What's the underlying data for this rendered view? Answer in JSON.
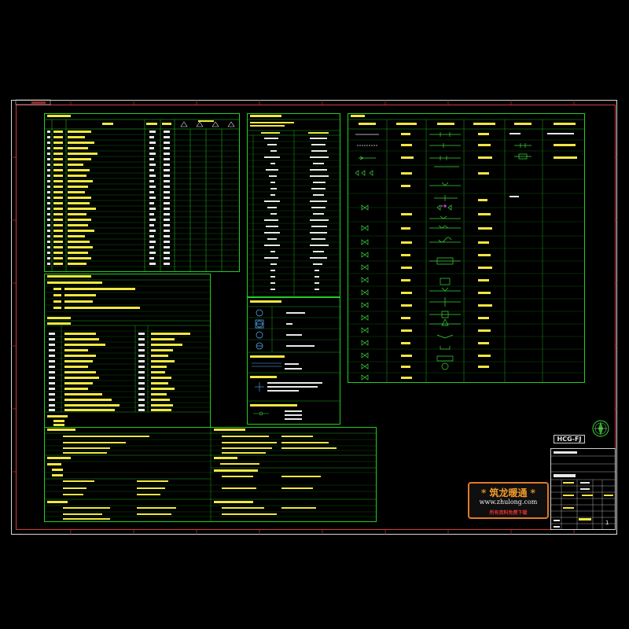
{
  "drawing": {
    "code": "HCG-FJ",
    "sheet_number": "1"
  },
  "watermark": {
    "title": "* 筑龙暖通 *",
    "url": "www.zhulong.com",
    "note": "所有资料免费下载"
  },
  "colors": {
    "background": "#000000",
    "table_border": "#1fcf1f",
    "frame_outer": "#d8d8d8",
    "frame_inner": "#d23a3a",
    "text_header": "#f2e641",
    "text_body": "#e8e8e8",
    "stamp_border": "#e07a22",
    "stamp_note": "#e03030"
  },
  "icons": [
    "north-arrow-icon",
    "valve-symbol-icon",
    "instrument-bubble-icon"
  ]
}
